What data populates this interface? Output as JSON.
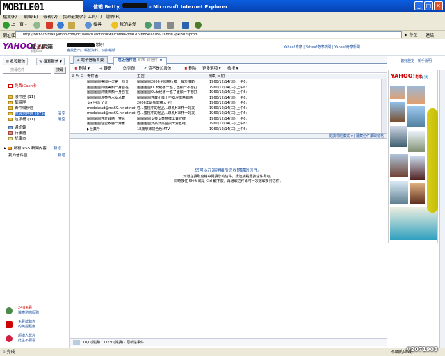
{
  "watermark_logo": "MOBILE01",
  "window": {
    "title": "信箱 Betty,",
    "title_suffix": "- Microsoft Internet Explorer"
  },
  "menu": [
    "檔案(F)",
    "編輯(E)",
    "檢視(V)",
    "我的最愛(A)",
    "工具(T)",
    "說明(H)"
  ],
  "toolbar": {
    "back": "上一頁",
    "search": "搜尋",
    "favorites": "我的最愛"
  },
  "address": {
    "label": "網址(D)",
    "url": "http://tw.f723.mail.yahoo.com/dc/launch?action=welcome&YY=20968840718&.rand=2pkl8d2sprofil",
    "go": "移至",
    "links": "連結"
  },
  "yahoo": {
    "logo": "YAHOO!",
    "logo_sub": "奇摩",
    "product": "電子信箱",
    "product_sub": "新版Beta",
    "greeting_prefix": "",
    "greeting_suffix": "您好！",
    "greeting_links": "會員登出，帳號資料，切換帳號",
    "top_links": "Yahoo!奇摩 | Yahoo!奇摩新聞 | Yahoo!奇摩新聞"
  },
  "sidebar": {
    "check_mail": "收發新信",
    "compose": "撰寫新信",
    "search_placeholder": "搜尋信件",
    "search_button": "搜尋",
    "icard": "免費iCash卡",
    "folders": [
      {
        "name": "收件匣 (11)",
        "right": ""
      },
      {
        "name": "草稿匣",
        "right": ""
      },
      {
        "name": "寄件備份匣",
        "right": ""
      },
      {
        "name": "垃圾信件匣 (675)",
        "right": "清空",
        "selected": true
      },
      {
        "name": "垃圾桶 (11)",
        "right": "清空"
      },
      {
        "name": "通訊錄",
        "right": ""
      },
      {
        "name": "行事曆",
        "right": ""
      },
      {
        "name": "記事本",
        "right": ""
      }
    ],
    "rss": "所有 RSS 新聞內容",
    "rss_right": "新增",
    "my_folders": "我的信件匣",
    "my_folders_right": "新增",
    "promos": [
      {
        "title": "24H免費",
        "sub": "醫療諮詢服務"
      },
      {
        "title": "免費試聽你",
        "sub": "的英語程度"
      },
      {
        "title": "超讚人影片",
        "sub": "此生不要看"
      }
    ]
  },
  "tabs": [
    {
      "label": "電子信箱首頁"
    },
    {
      "label": "垃圾信件匣",
      "count": "675 封信件",
      "active": true
    }
  ],
  "actions": [
    "刪除",
    "轉寄",
    "列印",
    "這不是垃圾信",
    "刪除",
    "更多選項",
    "檢視"
  ],
  "grid": {
    "headers": [
      "寄件者",
      "主旨",
      "修訂日期"
    ],
    "rows": [
      {
        "from": "圖圖圖圖美國巨型第一罰分",
        "subject": "圖圖圖圖2006全國排行榜一飆力推動",
        "date": "1960/12/14(三) 上午6:"
      },
      {
        "from": "圖圖圖圖商機美顏一身自在",
        "subject": "圖圖圖圖OL女秘書一惑了盡顯一不想打",
        "date": "1960/12/14(三) 上午6:"
      },
      {
        "from": "圖圖圖圖商機美顏一身自在",
        "subject": "圖圖圖圖OL女秘書一惑了盡顯一不想打",
        "date": "1960/12/14(三) 上午6:"
      },
      {
        "from": "圖圖圖圖漂亮浮水女孟藏",
        "subject": "圖圖圖圖性教小護士不安淫蕩無聽勝",
        "date": "1960/12/14(三) 上午6:"
      },
      {
        "from": "女✔明治 Y 介",
        "subject": "2006年最新健瘦大全！",
        "date": "1960/12/14(三) 上午6:"
      },
      {
        "from": "modpkead@ms69.hinet.net",
        "subject": "性...蜜桃中的極品...爆乳H罩杯一好友",
        "date": "1960/12/14(三) 上午6:"
      },
      {
        "from": "modpkead@ms69.hinet.net",
        "subject": "性...蜜桃中的極品...爆乳H罩杯一好友",
        "date": "1960/12/14(三) 上午6:"
      },
      {
        "from": "圖圖圖圖性愛致勝一穿著",
        "subject": "圖圖圖圖女孩女蒸盒摸出賣宣確",
        "date": "1960/12/14(三) 上午6:"
      },
      {
        "from": "圖圖圖圖性愛致勝一穿著",
        "subject": "圖圖圖圖女孩女蒸盒摸出賣宣確",
        "date": "1960/12/14(三) 上午6:"
      },
      {
        "from": "▶仕業号",
        "subject": "18歲學妹初色色MTV",
        "date": "1960/12/14(三) 上午6:"
      }
    ]
  },
  "splitter": {
    "left": "",
    "right": "閱讀標題模式 ▾ | 隱藏信件讀取窗格"
  },
  "preview": {
    "title": "您可以在這裡顯示您收閱讀的信件。",
    "line1": "知道在讀取窗格中閱讀您的信件，請連接點選該信件即可。",
    "line2": "同時按住 Shift 或是 Ctrl 鍵不放，再選取信件即可一次選取多封信件。"
  },
  "mailstatus": "10/0(閱讀) · 11/30(閱讀) · 原新信事件",
  "ad": {
    "top": "偏好設定 · 新手說明",
    "logo": "YAHOO!",
    "logo_sub": "奇摩",
    "logo2": "生活"
  },
  "status": {
    "left": "完成",
    "right": "不明的區域"
  },
  "watermark": "#2071903"
}
